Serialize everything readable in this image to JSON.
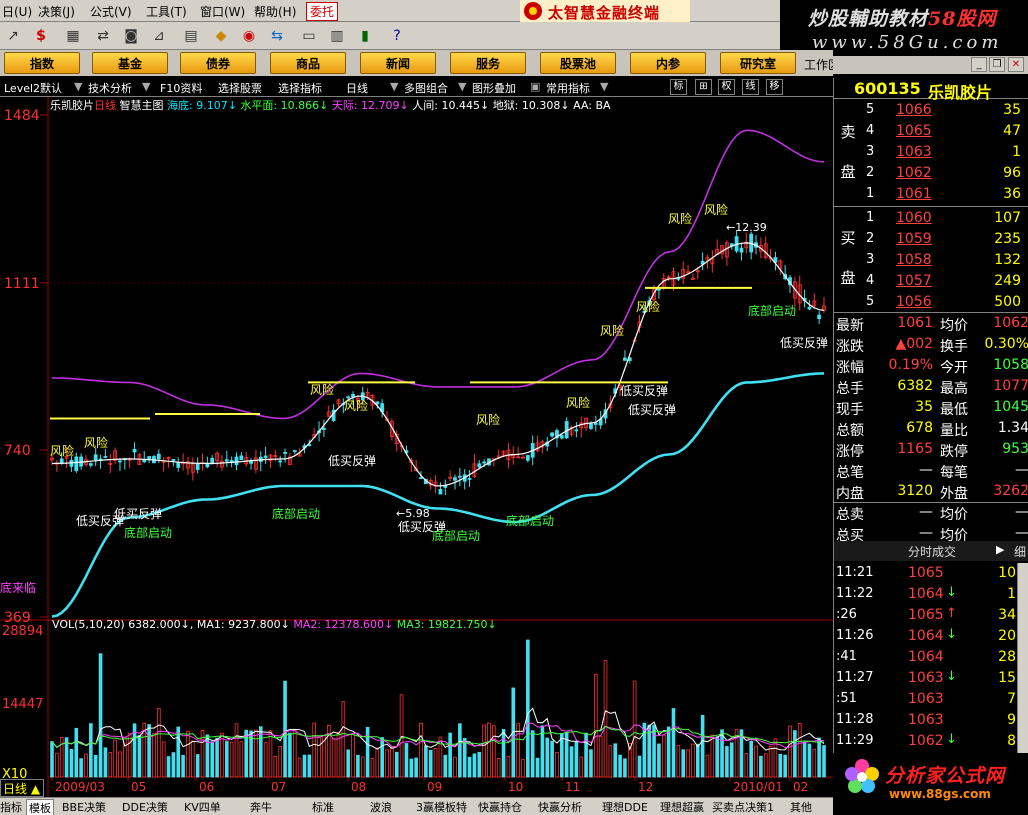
{
  "menu": {
    "items": [
      "日(U)",
      "决策(J)",
      "公式(V)",
      "工具(T)",
      "窗口(W)",
      "帮助(H)"
    ],
    "entrust": "委托",
    "brand_title": "太智慧金融终端"
  },
  "watermark": {
    "title_prefix": "炒股輔助教材",
    "title_site": "58股网",
    "url": "www.58Gu.com"
  },
  "toolbar": {
    "icons": [
      "pointer-icon",
      "dollar-icon",
      "list-icon",
      "binoculars-icon",
      "chart-icon",
      "grid-icon",
      "diamond-icon",
      "eye-icon",
      "exchange-icon",
      "screen-icon",
      "table-icon",
      "bars-icon",
      "help-icon"
    ]
  },
  "funcbar": {
    "buttons": [
      "指数",
      "基金",
      "债券",
      "商品",
      "新闻",
      "服务",
      "股票池",
      "内参",
      "研究室"
    ],
    "workspace": "工作区"
  },
  "chartbar": {
    "level": "Level2默认",
    "analysis": "技术分析",
    "f10": "F10资料",
    "pick_stock": "选择股票",
    "pick_indicator": "选择指标",
    "period": "日线",
    "multi": "多图组合",
    "overlay": "图形叠加",
    "common": "常用指标",
    "squares": [
      "标",
      "⊞",
      "权",
      "线",
      "移"
    ]
  },
  "chart": {
    "stock_label": "乐凯胶片",
    "period_label": "日线",
    "main_label": "智慧主图",
    "indicators": [
      {
        "name": "海底",
        "value": "9.107",
        "dir": "↓",
        "color": "#00e5ff"
      },
      {
        "name": "水平面",
        "value": "10.866",
        "dir": "↓",
        "color": "#40ff40"
      },
      {
        "name": "天际",
        "value": "12.709",
        "dir": "↓",
        "color": "#ff40ff"
      },
      {
        "name": "人间",
        "value": "10.445",
        "dir": "↓",
        "color": "#ffffff"
      },
      {
        "name": "地狱",
        "value": "10.308",
        "dir": "↓",
        "color": "#ffffff"
      },
      {
        "name": "AA",
        "value": "BA",
        "dir": "",
        "color": "#ffffff"
      }
    ],
    "price_axis": [
      "1484",
      "1111",
      "740",
      "369"
    ],
    "vol_axis": [
      "28894",
      "14447",
      "X10"
    ],
    "vol_label": "VOL(5,10,20)",
    "vol_value": "6382.000",
    "vol_indicators": [
      {
        "name": "MA1",
        "value": "9237.800",
        "dir": "↓",
        "color": "#ffffff"
      },
      {
        "name": "MA2",
        "value": "12378.600",
        "dir": "↓",
        "color": "#ff40ff"
      },
      {
        "name": "MA3",
        "value": "19821.750",
        "dir": "↓",
        "color": "#40ff40"
      }
    ],
    "dates": [
      "2009/03",
      "05",
      "06",
      "07",
      "08",
      "09",
      "10",
      "11",
      "12",
      "2010/01",
      "02"
    ],
    "signals": {
      "risk": "风险",
      "buy": "低买反弹",
      "start": "底部启动"
    },
    "peak_value": "12.39",
    "low_value": "5.98",
    "left_label": "底来临"
  },
  "chart_data": {
    "type": "line",
    "title": "乐凯胶片 日线",
    "ylim": [
      3.69,
      14.84
    ],
    "x": [
      "2009/03",
      "05",
      "06",
      "07",
      "08",
      "09",
      "10",
      "11",
      "12",
      "2010/01",
      "02"
    ],
    "series": [
      {
        "name": "天际",
        "values": [
          9.0,
          8.9,
          8.4,
          8.1,
          9.1,
          8.8,
          8.8,
          9.4,
          11.8,
          14.5,
          13.8
        ]
      },
      {
        "name": "人间",
        "values": [
          7.1,
          7.2,
          7.1,
          7.2,
          8.6,
          6.6,
          7.3,
          8.0,
          11.2,
          12.0,
          10.5
        ]
      },
      {
        "name": "海底",
        "values": [
          3.7,
          5.9,
          6.3,
          6.6,
          6.6,
          6.1,
          5.8,
          6.4,
          7.3,
          8.9,
          9.1
        ]
      }
    ]
  },
  "quote": {
    "code": "600135",
    "name": "乐凯胶片",
    "sell_label": [
      "卖",
      "盘"
    ],
    "buy_label": [
      "买",
      "盘"
    ],
    "sell": [
      {
        "level": "5",
        "price": "1066",
        "vol": "35"
      },
      {
        "level": "4",
        "price": "1065",
        "vol": "47"
      },
      {
        "level": "3",
        "price": "1063",
        "vol": "1"
      },
      {
        "level": "2",
        "price": "1062",
        "vol": "96"
      },
      {
        "level": "1",
        "price": "1061",
        "vol": "36"
      }
    ],
    "buy": [
      {
        "level": "1",
        "price": "1060",
        "vol": "107"
      },
      {
        "level": "2",
        "price": "1059",
        "vol": "235"
      },
      {
        "level": "3",
        "price": "1058",
        "vol": "132"
      },
      {
        "level": "4",
        "price": "1057",
        "vol": "249"
      },
      {
        "level": "5",
        "price": "1056",
        "vol": "500"
      }
    ],
    "stats": [
      {
        "l1": "最新",
        "v1": "1061",
        "c1": "red",
        "l2": "均价",
        "v2": "1062",
        "c2": "red"
      },
      {
        "l1": "涨跌",
        "v1": "▲002",
        "c1": "red",
        "l2": "换手",
        "v2": "0.30%",
        "c2": "yel"
      },
      {
        "l1": "涨幅",
        "v1": "0.19%",
        "c1": "red",
        "l2": "今开",
        "v2": "1058",
        "c2": "grn"
      },
      {
        "l1": "总手",
        "v1": "6382",
        "c1": "yel",
        "l2": "最高",
        "v2": "1077",
        "c2": "red"
      },
      {
        "l1": "现手",
        "v1": "35",
        "c1": "yel",
        "l2": "最低",
        "v2": "1045",
        "c2": "grn"
      },
      {
        "l1": "总额",
        "v1": "678",
        "c1": "yel",
        "l2": "量比",
        "v2": "1.34",
        "c2": "wht"
      },
      {
        "l1": "涨停",
        "v1": "1165",
        "c1": "red",
        "l2": "跌停",
        "v2": "953",
        "c2": "grn"
      },
      {
        "l1": "总笔",
        "v1": "—",
        "c1": "wht",
        "l2": "每笔",
        "v2": "—",
        "c2": "wht"
      },
      {
        "l1": "内盘",
        "v1": "3120",
        "c1": "yel",
        "l2": "外盘",
        "v2": "3262",
        "c2": "red"
      },
      {
        "l1": "总卖",
        "v1": "—",
        "c1": "wht",
        "l2": "均价",
        "v2": "—",
        "c2": "wht"
      },
      {
        "l1": "总买",
        "v1": "—",
        "c1": "wht",
        "l2": "均价",
        "v2": "—",
        "c2": "wht"
      }
    ],
    "tick_title": "分时成交",
    "tick_more": "细",
    "ticks": [
      {
        "time": "11:21",
        "price": "1065",
        "arrow": "",
        "vol": "10",
        "pc": "red"
      },
      {
        "time": "11:22",
        "price": "1064",
        "arrow": "↓",
        "vol": "1",
        "pc": "red"
      },
      {
        "time": ":26",
        "price": "1065",
        "arrow": "↑",
        "vol": "34",
        "pc": "red"
      },
      {
        "time": "11:26",
        "price": "1064",
        "arrow": "↓",
        "vol": "20",
        "pc": "red"
      },
      {
        "time": ":41",
        "price": "1064",
        "arrow": "",
        "vol": "28",
        "pc": "red"
      },
      {
        "time": "11:27",
        "price": "1063",
        "arrow": "↓",
        "vol": "15",
        "pc": "red"
      },
      {
        "time": ":51",
        "price": "1063",
        "arrow": "",
        "vol": "7",
        "pc": "red"
      },
      {
        "time": "11:28",
        "price": "1063",
        "arrow": "",
        "vol": "9",
        "pc": "red"
      },
      {
        "time": "11:29",
        "price": "1062",
        "arrow": "↓",
        "vol": "8",
        "pc": "red"
      }
    ]
  },
  "tabs": {
    "dayline": "日线",
    "items": [
      "指标",
      "模板",
      "BBE决策",
      "DDE决策",
      "KV四单",
      "奔牛",
      "标准",
      "波浪",
      "3赢模板特",
      "快赢持仓",
      "快赢分析",
      "理想DDE",
      "理想超赢",
      "买卖点决策1",
      "其他"
    ]
  },
  "bottom_logo": {
    "title": "分析家公式网",
    "url": "www.88gs.com"
  }
}
